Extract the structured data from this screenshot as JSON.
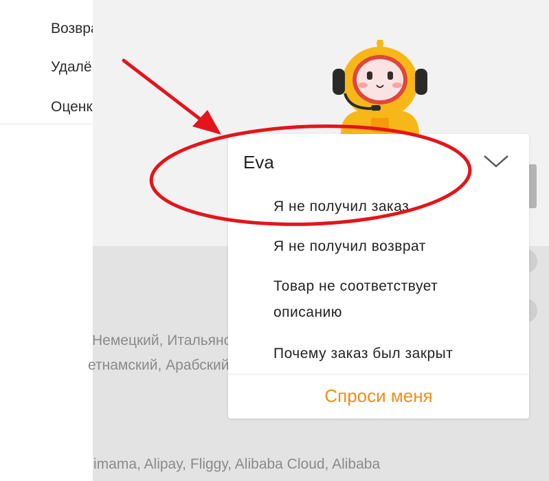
{
  "left_menu": {
    "items": [
      "Возврат",
      "Удалённые",
      "Оценка"
    ]
  },
  "background_text": {
    "languages_line1": "Немецкий, Итальянский,",
    "languages_line2": "етнамский, Арабский",
    "brands_line": "imama, Alipay, Fliggy, Alibaba Cloud, Alibaba"
  },
  "dropdown": {
    "selected": "Eva",
    "options": [
      "Я не получил заказ",
      "Я не получил возврат",
      "Товар не соответствует описанию",
      "Почему заказ был закрыт"
    ],
    "ask_button": "Спроси меня"
  },
  "colors": {
    "accent": "#f08c1a",
    "annotation_red": "#e3151a",
    "mascot_yellow": "#f7b718"
  },
  "icons": {
    "chevron": "chevron-down-icon",
    "mascot": "assistant-mascot-icon",
    "annotation": "red-arrow-and-circle"
  }
}
